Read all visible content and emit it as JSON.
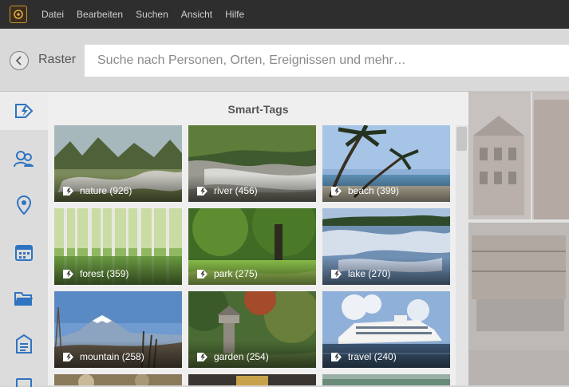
{
  "menubar": {
    "items": [
      "Datei",
      "Bearbeiten",
      "Suchen",
      "Ansicht",
      "Hilfe"
    ]
  },
  "toolbar": {
    "view_label": "Raster",
    "search_placeholder": "Suche nach Personen, Orten, Ereignissen und mehr…"
  },
  "sidebar": {
    "icons": [
      "smart-tags-icon",
      "people-icon",
      "places-icon",
      "events-icon",
      "folders-icon",
      "albums-icon"
    ]
  },
  "panel": {
    "title": "Smart-Tags",
    "tiles": [
      {
        "label": "nature (926)",
        "name": "nature"
      },
      {
        "label": "river (456)",
        "name": "river"
      },
      {
        "label": "beach (399)",
        "name": "beach"
      },
      {
        "label": "forest (359)",
        "name": "forest"
      },
      {
        "label": "park (275)",
        "name": "park"
      },
      {
        "label": "lake (270)",
        "name": "lake"
      },
      {
        "label": "mountain (258)",
        "name": "mountain"
      },
      {
        "label": "garden (254)",
        "name": "garden"
      },
      {
        "label": "travel (240)",
        "name": "travel"
      }
    ]
  },
  "colors": {
    "menubar": "#2e2e2e",
    "icon_blue": "#2f74c0"
  }
}
